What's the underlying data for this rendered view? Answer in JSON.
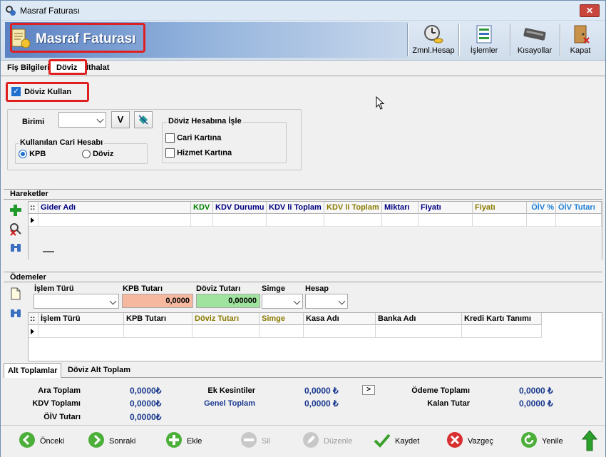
{
  "window": {
    "title": "Masraf Faturası"
  },
  "banner": {
    "title": "Masraf Faturası"
  },
  "toolbar": {
    "zmnl_label": "Zmnl.Hesap",
    "islemler_label": "İşlemler",
    "kisayollar_label": "Kısayollar",
    "kapat_label": "Kapat"
  },
  "tabs": [
    "Fiş Bilgileri",
    "Döviz",
    "İthalat"
  ],
  "doviz": {
    "kullan_label": "Döviz Kullan",
    "birimi_label": "Birimi",
    "v_button": "V",
    "hesap_group_title": "Döviz Hesabına İşle",
    "cari_kartina": "Cari Kartına",
    "hizmet_kartina": "Hizmet Kartına",
    "cari_hesap_title": "Kullanılan Cari Hesabı",
    "kpb_label": "KPB",
    "doviz_label": "Döviz"
  },
  "hareketler": {
    "title": "Hareketler",
    "columns": [
      "Gider Adı",
      "KDV",
      "KDV Durumu",
      "KDV li Toplam",
      "KDV li Toplam",
      "Miktarı",
      "Fiyatı",
      "Fiyatı",
      "ÖİV %",
      "ÖİV Tutarı"
    ],
    "column_colors": [
      "#000080",
      "#008000",
      "#000080",
      "#000080",
      "#8a7a00",
      "#000080",
      "#000080",
      "#8a7a00",
      "#1e7fd6",
      "#1e7fd6"
    ]
  },
  "odemeler": {
    "title": "Ödemeler",
    "islem_turu_label": "İşlem Türü",
    "kpb_tutari_label": "KPB Tutarı",
    "doviz_tutari_label": "Döviz Tutarı",
    "simge_label": "Simge",
    "hesap_label": "Hesap",
    "kpb_value": "0,0000",
    "doviz_value": "0,00000",
    "columns": [
      "İşlem Türü",
      "KPB Tutarı",
      "Döviz Tutarı",
      "Simge",
      "Kasa Adı",
      "Banka Adı",
      "Kredi Kartı Tanımı"
    ],
    "column_colors": [
      "#000000",
      "#000000",
      "#8a7a00",
      "#8a7a00",
      "#000000",
      "#000000",
      "#000000"
    ]
  },
  "bottom_tabs": [
    "Alt Toplamlar",
    "Döviz Alt Toplam"
  ],
  "totals": {
    "ara_toplam_label": "Ara Toplam",
    "ara_toplam": "0,0000₺",
    "kdv_toplami_label": "KDV Toplamı",
    "kdv_toplami": "0,0000₺",
    "oiv_tutari_label": "ÖİV Tutarı",
    "oiv_tutari": "0,0000₺",
    "ek_kesintiler_label": "Ek Kesintiler",
    "ek_kesintiler": "0,0000 ₺",
    "genel_toplam_label": "Genel Toplam",
    "genel_toplam": "0,0000 ₺",
    "expand_button": ">",
    "odeme_toplami_label": "Ödeme Toplamı",
    "odeme_toplami": "0,0000 ₺",
    "kalan_tutar_label": "Kalan Tutar",
    "kalan_tutar": "0,0000 ₺"
  },
  "actions": {
    "onceki": "Önceki",
    "sonraki": "Sonraki",
    "ekle": "Ekle",
    "sil": "Sil",
    "duzenle": "Düzenle",
    "kaydet": "Kaydet",
    "vazgec": "Vazgeç",
    "yenile": "Yenile"
  }
}
